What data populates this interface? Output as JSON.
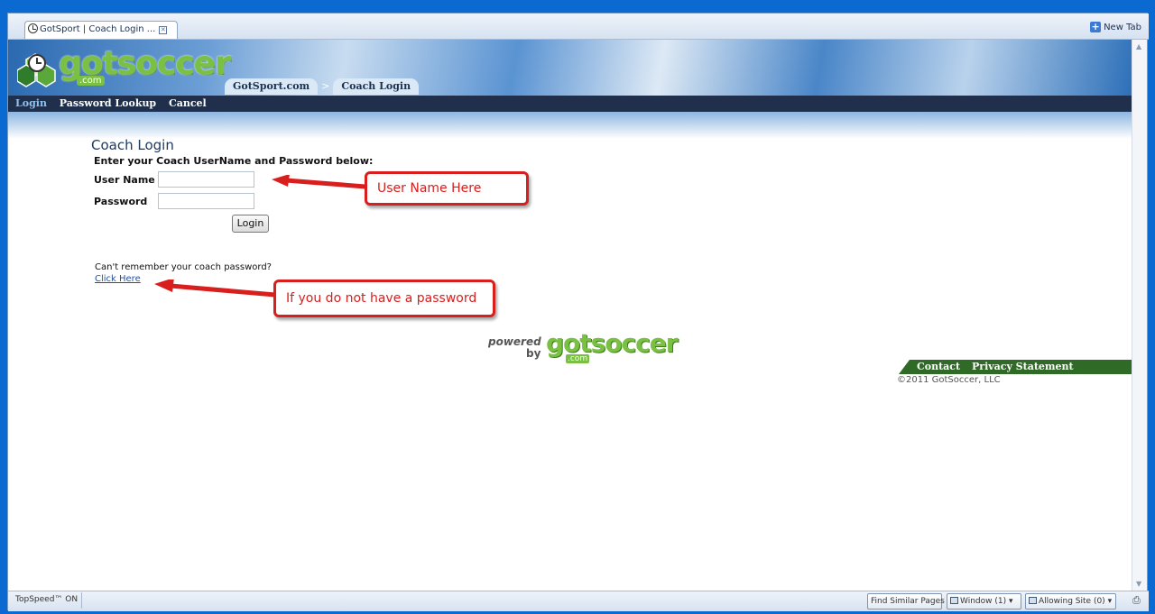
{
  "browser": {
    "tab_title": "GotSport | Coach Login ...",
    "new_tab_label": "New Tab"
  },
  "header": {
    "logo_text": "gotsoccer",
    "logo_suffix": ".com",
    "breadcrumbs": [
      "GotSport.com",
      "Coach Login"
    ],
    "separator": ">"
  },
  "nav": {
    "items": [
      "Login",
      "Password Lookup",
      "Cancel"
    ]
  },
  "login": {
    "title": "Coach Login",
    "instructions": "Enter your Coach UserName and Password below:",
    "username_label": "User Name",
    "username_value": "",
    "password_label": "Password",
    "password_value": "",
    "button_label": "Login",
    "forgot_text": "Can't remember your coach password?",
    "forgot_link": "Click Here"
  },
  "annotations": {
    "username_callout": "User Name Here",
    "password_callout": "If you do not have a password",
    "color": "#d91e1e"
  },
  "powered": {
    "powered": "powered",
    "by": "by",
    "brand": "gotsoccer",
    "suffix": ".com"
  },
  "footer": {
    "contact": "Contact",
    "privacy": "Privacy Statement",
    "copyright": "©2011 GotSoccer, LLC"
  },
  "statusbar": {
    "topspeed": "TopSpeed™ ON",
    "find_similar": "Find Similar Pages",
    "window": "Window (1)",
    "allowing_site": "Allowing Site (0)"
  },
  "colors": {
    "nav_bg": "#1f2f4c",
    "brand_green": "#7ac143",
    "footer_green": "#2f6a26",
    "desktop_blue": "#0a6ad2"
  }
}
